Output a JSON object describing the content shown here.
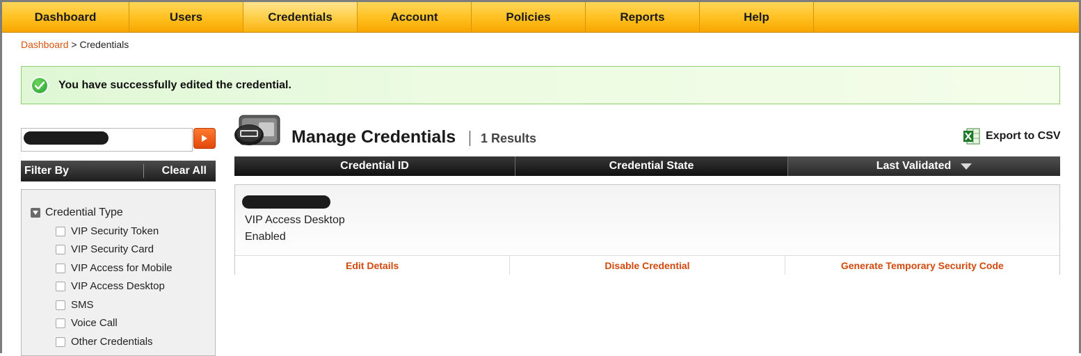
{
  "nav": {
    "tabs": [
      {
        "label": "Dashboard"
      },
      {
        "label": "Users"
      },
      {
        "label": "Credentials"
      },
      {
        "label": "Account"
      },
      {
        "label": "Policies"
      },
      {
        "label": "Reports"
      },
      {
        "label": "Help"
      }
    ],
    "active": "Credentials"
  },
  "breadcrumb": {
    "root": "Dashboard",
    "separator": ">",
    "current": "Credentials"
  },
  "alert": {
    "message": "You have successfully edited the credential.",
    "icon": "check-circle-icon"
  },
  "sidebar": {
    "search": {
      "value": "",
      "button_icon": "play-arrow-icon"
    },
    "filter_label": "Filter By",
    "clear_all": "Clear All",
    "group": {
      "label": "Credential Type",
      "options": [
        {
          "label": "VIP Security Token",
          "checked": false
        },
        {
          "label": "VIP Security Card",
          "checked": false
        },
        {
          "label": "VIP Access for Mobile",
          "checked": false
        },
        {
          "label": "VIP Access Desktop",
          "checked": false
        },
        {
          "label": "SMS",
          "checked": false
        },
        {
          "label": "Voice Call",
          "checked": false
        },
        {
          "label": "Other Credentials",
          "checked": false
        }
      ]
    }
  },
  "main": {
    "title": "Manage Credentials",
    "separator": "|",
    "results": "1 Results",
    "export_label": "Export to CSV",
    "export_icon": "excel-icon",
    "columns": [
      {
        "label": "Credential ID"
      },
      {
        "label": "Credential State"
      },
      {
        "label": "Last Validated"
      }
    ],
    "row": {
      "credential_type": "VIP Access Desktop",
      "state": "Enabled",
      "actions": [
        {
          "label": "Edit Details"
        },
        {
          "label": "Disable Credential"
        },
        {
          "label": "Generate Temporary Security Code"
        }
      ]
    }
  },
  "colors": {
    "nav_orange": "#ffbf1e",
    "link_orange": "#d9530f",
    "success_green": "#8fcf6f"
  }
}
